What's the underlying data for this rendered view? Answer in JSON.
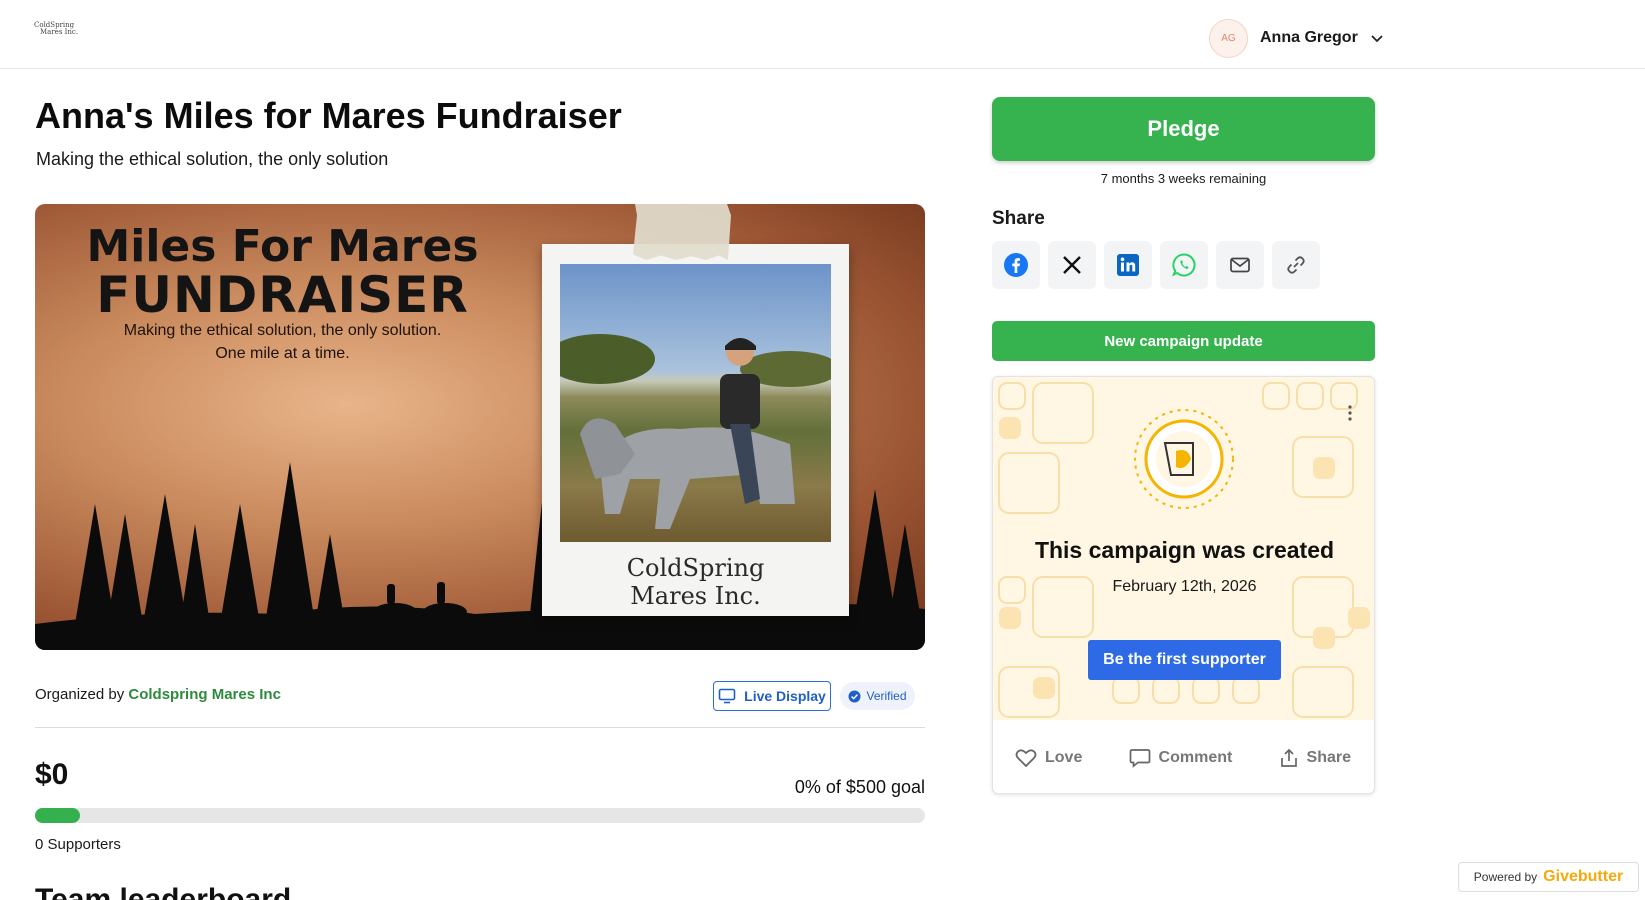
{
  "header": {
    "logo_line1": "ColdSpring",
    "logo_line2": "Mares Inc.",
    "avatar_initials": "AG",
    "user_name": "Anna Gregor"
  },
  "campaign": {
    "title": "Anna's Miles for Mares Fundraiser",
    "subtitle": "Making the ethical solution, the only solution"
  },
  "hero": {
    "heading_line1": "Miles For Mares",
    "heading_line2": "FUNDRAISER",
    "tagline_line1": "Making the ethical solution, the only solution.",
    "tagline_line2": "One mile at a time.",
    "polaroid_caption_line1": "ColdSpring",
    "polaroid_caption_line2": "Mares Inc."
  },
  "organizer": {
    "prefix": "Organized by ",
    "name": "Coldspring Mares Inc",
    "live_display_label": "Live Display",
    "verified_label": "Verified"
  },
  "stats": {
    "raised": "$0",
    "goal_text": "0% of $500 goal",
    "progress_fraction": 0.05,
    "supporters": "0 Supporters",
    "next_heading": "Team leaderboard"
  },
  "sidebar": {
    "pledge_label": "Pledge",
    "remaining": "7 months 3 weeks remaining",
    "share_heading": "Share",
    "share_buttons": [
      "facebook-icon",
      "x-icon",
      "linkedin-icon",
      "whatsapp-icon",
      "email-icon",
      "link-icon"
    ],
    "update_label": "New campaign update"
  },
  "activity_card": {
    "title": "This campaign was created",
    "date": "February 12th, 2026",
    "cta_label": "Be the first supporter",
    "love_label": "Love",
    "comment_label": "Comment",
    "share_label": "Share"
  },
  "footer": {
    "powered_prefix": "Powered by",
    "brand": "Givebutter"
  },
  "colors": {
    "brand_green": "#36b24f",
    "link_green": "#2f8a3e",
    "cta_blue": "#2f6ae6",
    "givebutter_yellow": "#f6a90c"
  }
}
